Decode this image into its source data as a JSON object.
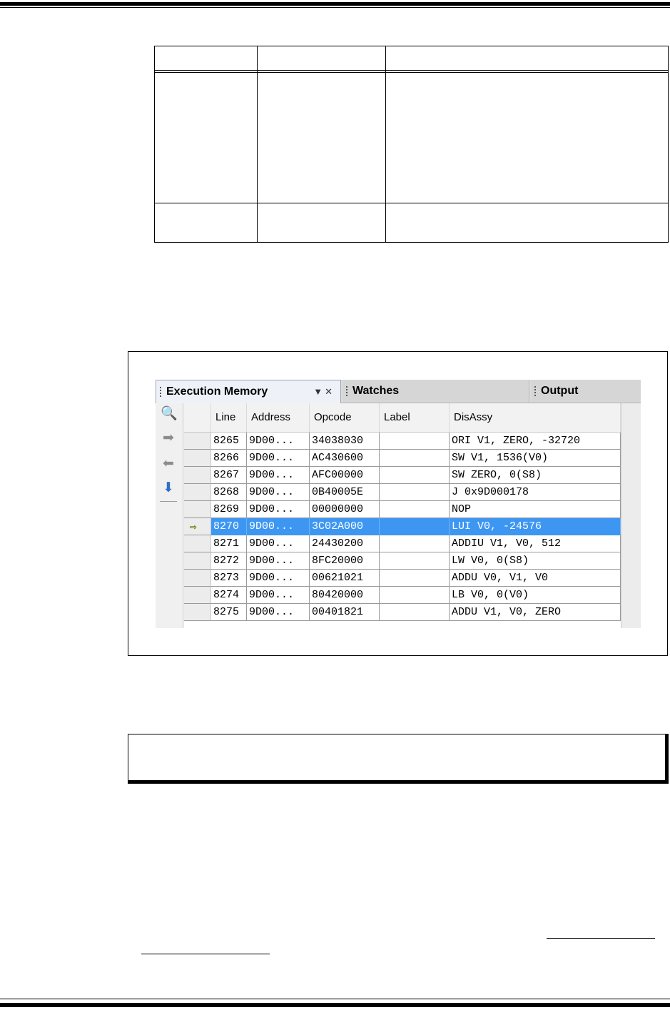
{
  "ide": {
    "tabs": {
      "execution_memory": "Execution Memory",
      "watches": "Watches",
      "output": "Output"
    },
    "columns": [
      "Line",
      "Address",
      "Opcode",
      "Label",
      "DisAssy"
    ],
    "current_line": "8270",
    "rows": [
      {
        "line": "8265",
        "address": "9D00...",
        "opcode": "34038030",
        "label": "",
        "disassy": "ORI V1, ZERO, -32720"
      },
      {
        "line": "8266",
        "address": "9D00...",
        "opcode": "AC430600",
        "label": "",
        "disassy": "SW V1, 1536(V0)"
      },
      {
        "line": "8267",
        "address": "9D00...",
        "opcode": "AFC00000",
        "label": "",
        "disassy": "SW ZERO, 0(S8)"
      },
      {
        "line": "8268",
        "address": "9D00...",
        "opcode": "0B40005E",
        "label": "",
        "disassy": "J 0x9D000178"
      },
      {
        "line": "8269",
        "address": "9D00...",
        "opcode": "00000000",
        "label": "",
        "disassy": "NOP"
      },
      {
        "line": "8270",
        "address": "9D00...",
        "opcode": "3C02A000",
        "label": "",
        "disassy": "LUI V0, -24576"
      },
      {
        "line": "8271",
        "address": "9D00...",
        "opcode": "24430200",
        "label": "",
        "disassy": "ADDIU V1, V0, 512"
      },
      {
        "line": "8272",
        "address": "9D00...",
        "opcode": "8FC20000",
        "label": "",
        "disassy": "LW V0, 0(S8)"
      },
      {
        "line": "8273",
        "address": "9D00...",
        "opcode": "00621021",
        "label": "",
        "disassy": "ADDU V0, V1, V0"
      },
      {
        "line": "8274",
        "address": "9D00...",
        "opcode": "80420000",
        "label": "",
        "disassy": "LB V0, 0(V0)"
      },
      {
        "line": "8275",
        "address": "9D00...",
        "opcode": "00401821",
        "label": "",
        "disassy": "ADDU V1, V0, ZERO"
      }
    ]
  }
}
